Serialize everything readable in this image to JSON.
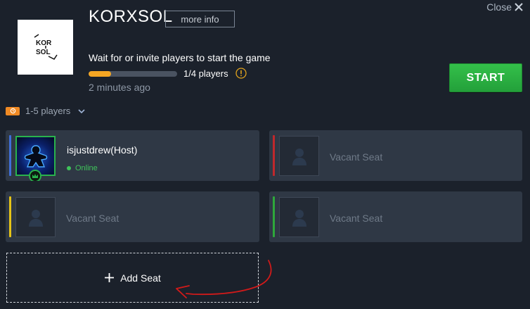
{
  "window": {
    "close_label": "Close"
  },
  "game": {
    "title": "KORXSOL",
    "more_info_label": "more info",
    "logo_text_top": "KOR",
    "logo_text_bottom": "SOL"
  },
  "lobby": {
    "wait_text": "Wait for or invite players to start the game",
    "progress_fraction": 0.25,
    "player_count_text": "1/4 players",
    "time_ago": "2 minutes ago",
    "start_label": "START",
    "players_range": "1-5 players"
  },
  "seats": [
    {
      "kind": "host",
      "name": "isjustdrew(Host)",
      "status": "Online",
      "stripe_color": "#3f6fd8"
    },
    {
      "kind": "vacant",
      "label": "Vacant Seat",
      "stripe_color": "#c0282c"
    },
    {
      "kind": "vacant",
      "label": "Vacant Seat",
      "stripe_color": "#e6c417"
    },
    {
      "kind": "vacant",
      "label": "Vacant Seat",
      "stripe_color": "#2ea83b"
    }
  ],
  "add_seat_label": "Add Seat",
  "colors": {
    "accent_orange": "#f5a623",
    "start_green": "#2bb043",
    "online_green": "#3fc35a",
    "annotation_red": "#d11a1a"
  },
  "icons": {
    "close": "close-x-icon",
    "warning": "warning-circle-icon",
    "expand": "chevron-down-icon",
    "seat_placeholder": "person-silhouette-icon",
    "host_avatar": "meeple-icon",
    "host_badge": "crown-icon",
    "add": "plus-icon"
  }
}
